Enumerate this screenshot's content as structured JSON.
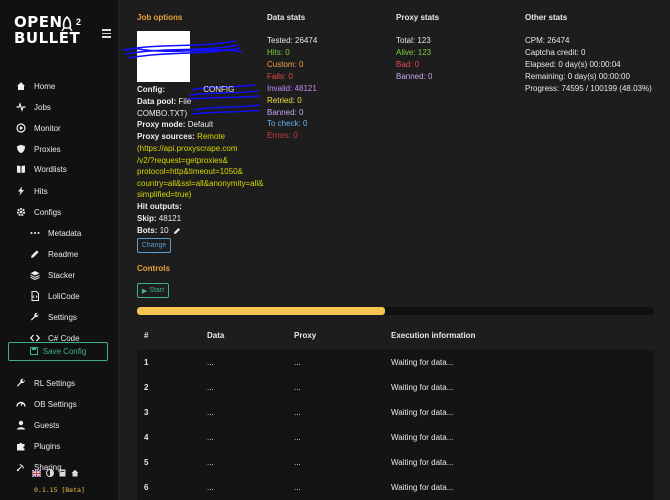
{
  "app": {
    "logo_line1": "OPEN",
    "logo_line2": "BULLET",
    "logo_sup": "2",
    "version": "0.1.15 [Beta]"
  },
  "sidebar": {
    "items": [
      {
        "label": "Home",
        "icon": "home-icon"
      },
      {
        "label": "Jobs",
        "icon": "pulse-icon"
      },
      {
        "label": "Monitor",
        "icon": "monitor-icon"
      },
      {
        "label": "Proxies",
        "icon": "shield-icon"
      },
      {
        "label": "Wordlists",
        "icon": "book-icon"
      },
      {
        "label": "Hits",
        "icon": "bolt-icon"
      },
      {
        "label": "Configs",
        "icon": "gear-icon"
      },
      {
        "label": "Metadata",
        "icon": "dots-icon"
      },
      {
        "label": "Readme",
        "icon": "pencil-icon"
      },
      {
        "label": "Stacker",
        "icon": "layers-icon"
      },
      {
        "label": "LoliCode",
        "icon": "code-file-icon"
      },
      {
        "label": "Settings",
        "icon": "wrench-icon"
      },
      {
        "label": "C# Code",
        "icon": "code-icon"
      },
      {
        "label": "RL Settings",
        "icon": "wrench-icon"
      },
      {
        "label": "OB Settings",
        "icon": "gauge-icon"
      },
      {
        "label": "Guests",
        "icon": "user-icon"
      },
      {
        "label": "Plugins",
        "icon": "puzzle-icon"
      },
      {
        "label": "Sharing",
        "icon": "satellite-icon"
      }
    ],
    "save_config": "Save Config"
  },
  "job_options": {
    "title": "Job options",
    "config_label": "Config:",
    "config_value": "CONFIG",
    "data_pool_label": "Data pool:",
    "data_pool_value": "File",
    "data_pool_line2": "COMBO.TXT)",
    "proxy_mode_label": "Proxy mode:",
    "proxy_mode_value": "Default",
    "proxy_sources_label": "Proxy sources:",
    "proxy_sources_value": "Remote",
    "proxy_url_lines": [
      "(https://api.proxyscrape.com",
      "/v2/?request=getproxies&",
      "protocol=http&timeout=1050&",
      "country=all&ssl=all&anonymity=all&",
      "simplified=true)"
    ],
    "hit_outputs_label": "Hit outputs:",
    "skip_label": "Skip:",
    "skip_value": "48121",
    "bots_label": "Bots:",
    "bots_value": "10",
    "change_button": "Change"
  },
  "data_stats": {
    "title": "Data stats",
    "tested": "Tested: 26474",
    "hits": "Hits: 0",
    "custom": "Custom: 0",
    "fails": "Fails: 0",
    "invalid": "Invalid: 48121",
    "retried": "Retried: 0",
    "banned": "Banned: 0",
    "to_check": "To check: 0",
    "errors": "Errors: 0"
  },
  "proxy_stats": {
    "title": "Proxy stats",
    "total": "Total: 123",
    "alive": "Alive: 123",
    "bad": "Bad: 0",
    "banned": "Banned: 0"
  },
  "other_stats": {
    "title": "Other stats",
    "cpm": "CPM: 26474",
    "captcha": "Captcha credit: 0",
    "elapsed": "Elapsed: 0 day(s) 00:00:04",
    "remaining": "Remaining: 0 day(s) 00:00:00",
    "progress": "Progress: 74595 / 100199 (48.03%)"
  },
  "controls": {
    "title": "Controls",
    "start_button": "Start",
    "progress_fraction": 0.48
  },
  "table": {
    "headers": [
      "#",
      "Data",
      "Proxy",
      "Execution information"
    ],
    "rows": [
      {
        "n": "1",
        "data": "...",
        "proxy": "...",
        "info": "Waiting for data..."
      },
      {
        "n": "2",
        "data": "...",
        "proxy": "...",
        "info": "Waiting for data..."
      },
      {
        "n": "3",
        "data": "...",
        "proxy": "...",
        "info": "Waiting for data..."
      },
      {
        "n": "4",
        "data": "...",
        "proxy": "...",
        "info": "Waiting for data..."
      },
      {
        "n": "5",
        "data": "...",
        "proxy": "...",
        "info": "Waiting for data..."
      },
      {
        "n": "6",
        "data": "...",
        "proxy": "...",
        "info": "Waiting for data..."
      }
    ]
  }
}
